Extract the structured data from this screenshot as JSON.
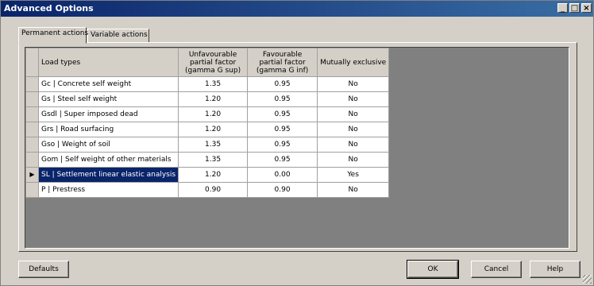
{
  "window": {
    "title": "Advanced Options",
    "controls": {
      "minimize": "_",
      "maximize": "□",
      "close": "×"
    }
  },
  "tabs": [
    {
      "label": "Permanent actions"
    },
    {
      "label": "Variable actions"
    }
  ],
  "table": {
    "headers": {
      "load_types": "Load types",
      "unfavourable": "Unfavourable partial factor (gamma G sup)",
      "favourable": "Favourable partial factor (gamma G inf)",
      "mutually_exclusive": "Mutually exclusive"
    },
    "rows": [
      {
        "load_type": "Gc | Concrete self weight",
        "unfav": "1.35",
        "fav": "0.95",
        "mutex": "No"
      },
      {
        "load_type": "Gs | Steel self weight",
        "unfav": "1.20",
        "fav": "0.95",
        "mutex": "No"
      },
      {
        "load_type": "Gsdl | Super imposed dead",
        "unfav": "1.20",
        "fav": "0.95",
        "mutex": "No"
      },
      {
        "load_type": "Grs | Road surfacing",
        "unfav": "1.20",
        "fav": "0.95",
        "mutex": "No"
      },
      {
        "load_type": "Gso | Weight of soil",
        "unfav": "1.35",
        "fav": "0.95",
        "mutex": "No"
      },
      {
        "load_type": "Gom | Self weight of other materials",
        "unfav": "1.35",
        "fav": "0.95",
        "mutex": "No"
      },
      {
        "load_type": "SL | Settlement linear elastic analysis",
        "unfav": "1.20",
        "fav": "0.00",
        "mutex": "Yes"
      },
      {
        "load_type": "P | Prestress",
        "unfav": "0.90",
        "fav": "0.90",
        "mutex": "No"
      }
    ],
    "current_row_indicator": "▶"
  },
  "buttons": {
    "defaults": "Defaults",
    "ok": "OK",
    "cancel": "Cancel",
    "help": "Help"
  },
  "colors": {
    "title_bar": "#0a246a",
    "selection": "#0a246a",
    "face": "#d4d0c8",
    "grid_background": "#808080"
  }
}
